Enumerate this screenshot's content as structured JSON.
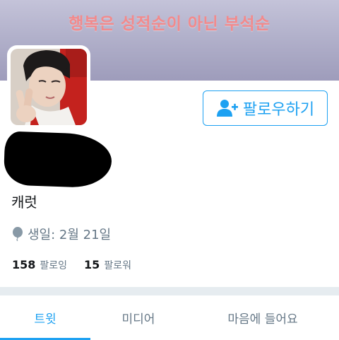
{
  "header": {
    "banner_text": "행복은 성적순이 아닌 부석순"
  },
  "profile": {
    "avatar_icon": "profile-photo",
    "follow_button_label": "팔로우하기",
    "follow_icon": "add-user-icon",
    "handle": "캐럿",
    "birthday_icon": "balloon-icon",
    "birthday_text": "생일: 2월 21일",
    "following_count": "158",
    "following_label": "팔로잉",
    "followers_count": "15",
    "followers_label": "팔로워"
  },
  "tabs": [
    {
      "label": "트윗",
      "active": true
    },
    {
      "label": "미디어",
      "active": false
    },
    {
      "label": "마음에 들어요",
      "active": false
    }
  ],
  "colors": {
    "accent": "#1da1f2",
    "banner_text": "#f28a8c",
    "muted": "#657786"
  }
}
